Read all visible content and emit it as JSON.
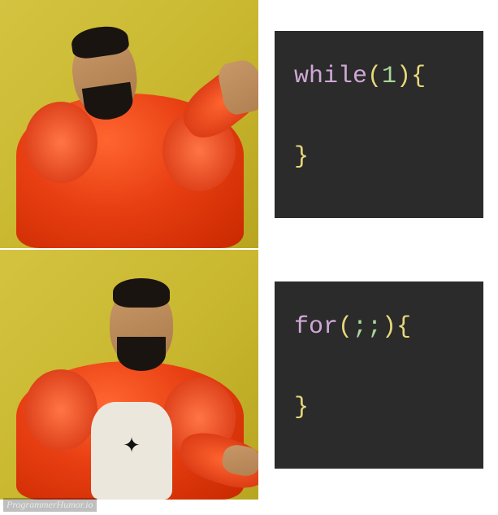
{
  "meme": {
    "format": "drake-hotline-bling",
    "top": {
      "reaction": "reject",
      "code": {
        "keyword": "while",
        "open_paren": "(",
        "arg": "1",
        "close_paren": ")",
        "open_brace": "{",
        "close_brace": "}"
      }
    },
    "bottom": {
      "reaction": "approve",
      "code": {
        "keyword": "for",
        "open_paren": "(",
        "arg": ";;",
        "close_paren": ")",
        "open_brace": "{",
        "close_brace": "}"
      }
    }
  },
  "watermark": "ProgrammerHumor.io",
  "colors": {
    "code_bg": "#2b2b2b",
    "keyword": "#cfa8d6",
    "paren_brace": "#e8d87a",
    "number": "#a7d89a",
    "jacket": "#e83f12",
    "panel_bg": "#c9b830"
  }
}
